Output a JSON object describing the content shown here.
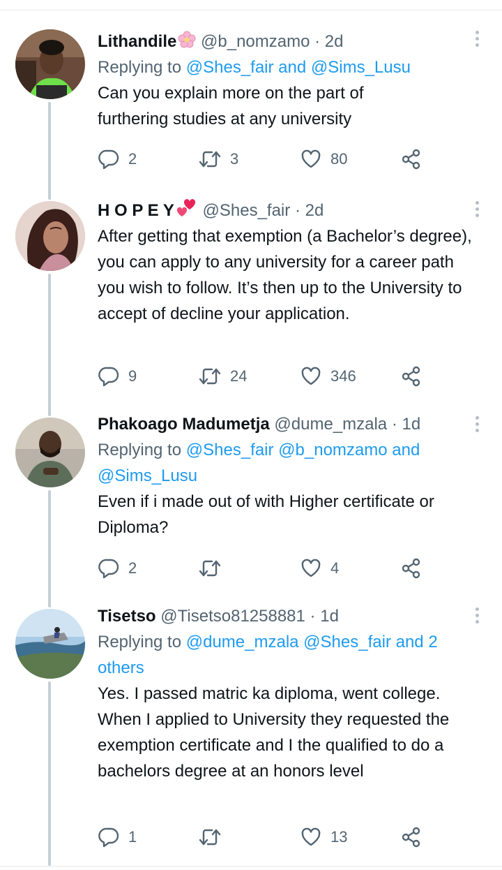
{
  "tweets": [
    {
      "name": "Lithandile",
      "handle": "@b_nomzamo",
      "time": "2d",
      "replying_prefix": "Replying to",
      "replying_to": "@Shes_fair and @Sims_Lusu",
      "text": "Can you explain more on the part of furthering studies at any university",
      "replies": "2",
      "retweets": "3",
      "likes": "80",
      "emoji_icon": "cherry-blossom-icon"
    },
    {
      "name": "H O P E Y",
      "handle": "@Shes_fair",
      "time": "2d",
      "text": "After getting that exemption (a Bachelor’s degree), you can apply to any university for a career path you wish to follow. It’s then up to the University to accept of decline your application.",
      "replies": "9",
      "retweets": "24",
      "likes": "346",
      "emoji_icon": "two-hearts-icon"
    },
    {
      "name": "Phakoago Madumetja",
      "handle": "@dume_mzala",
      "time": "1d",
      "replying_prefix": "Replying to",
      "replying_to": "@Shes_fair @b_nomzamo and @Sims_Lusu",
      "text": "Even if i made out of with Higher certificate or Diploma?",
      "replies": "2",
      "retweets": "",
      "likes": "4"
    },
    {
      "name": "Tisetso",
      "handle": "@Tisetso81258881",
      "time": "1d",
      "replying_prefix": "Replying to",
      "replying_to": "@dume_mzala @Shes_fair and 2 others",
      "text": "Yes. I passed matric ka diploma, went college. When I applied to University they requested the exemption certificate and I the qualified to do a bachelors degree at an honors level",
      "replies": "1",
      "retweets": "",
      "likes": "13"
    }
  ],
  "icons": {
    "reply": "reply-bubble-icon",
    "retweet": "retweet-arrows-icon",
    "like": "heart-outline-icon",
    "share": "share-nodes-icon",
    "more": "more-vertical-dots-icon"
  },
  "colors": {
    "link": "#1d9bf0",
    "secondary_text": "#536471",
    "primary_text": "#0f1419",
    "thread_line": "#c4cfd6"
  }
}
